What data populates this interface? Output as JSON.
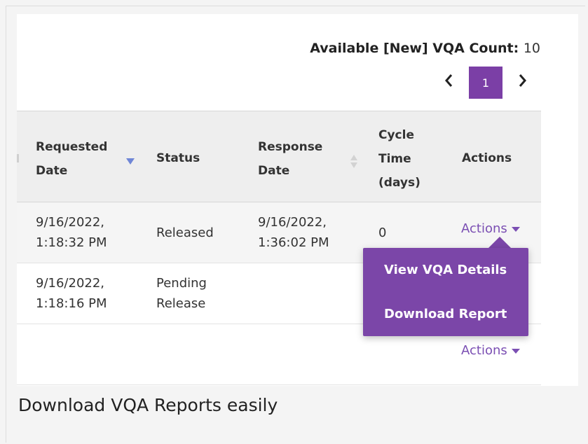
{
  "header": {
    "count_label": "Available [New] VQA Count:",
    "count_value": "10"
  },
  "pagination": {
    "current_page": "1",
    "prev_icon": "chevron-left-icon",
    "next_icon": "chevron-right-icon"
  },
  "table": {
    "columns": [
      {
        "line1": "Requested",
        "line2": "Date",
        "sort": "descending"
      },
      {
        "label": "Status"
      },
      {
        "line1": "Response",
        "line2": "Date",
        "sort": "sortable"
      },
      {
        "line1": "Cycle",
        "line2": "Time",
        "line3": "(days)"
      },
      {
        "label": "Actions"
      }
    ],
    "rows": [
      {
        "requested_date": "9/16/2022,",
        "requested_time": "1:18:32 PM",
        "status": "Released",
        "response_date": "9/16/2022,",
        "response_time": "1:36:02 PM",
        "cycle_time": "0",
        "action_label": "Actions"
      },
      {
        "requested_date": "9/16/2022,",
        "requested_time": "1:18:16 PM",
        "status_line1": "Pending",
        "status_line2": "Release",
        "response_date": "",
        "response_time": "",
        "cycle_time": "",
        "action_label": ""
      },
      {
        "requested_date": "",
        "requested_time": "",
        "status": "",
        "response_date": "",
        "response_time": "",
        "cycle_time": "",
        "action_label": "Actions"
      }
    ]
  },
  "actions_menu": {
    "items": [
      "View VQA Details",
      "Download Report"
    ]
  },
  "caption": "Download VQA Reports easily",
  "colors": {
    "accent": "#7b3fa6",
    "menu_bg": "#7b46a8",
    "link": "#7b4fb3",
    "sort_active": "#6f86d6"
  }
}
